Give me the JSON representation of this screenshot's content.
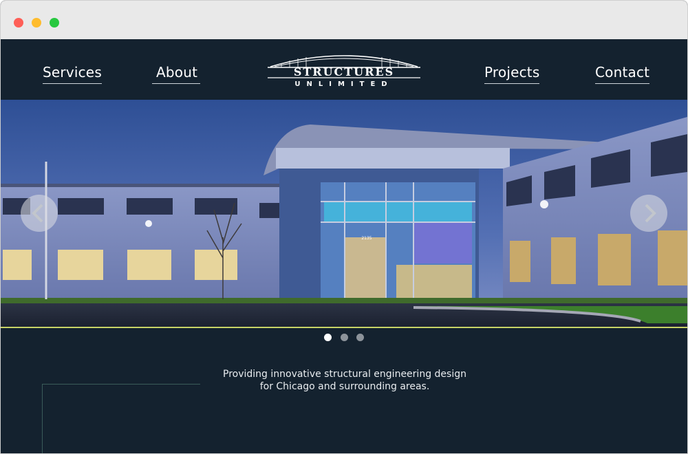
{
  "nav": {
    "left_links": [
      "Services",
      "About"
    ],
    "right_links": [
      "Projects",
      "Contact"
    ]
  },
  "logo": {
    "line1": "STRUCTURES",
    "line2": "UNLIMITED"
  },
  "hero": {
    "building_number": "2135",
    "slider": {
      "total_slides": 3,
      "active_slide": 1
    }
  },
  "tagline": {
    "line1": "Providing innovative structural engineering design",
    "line2": "for Chicago and surrounding areas."
  },
  "colors": {
    "background": "#14222f",
    "accent_line": "#c8d266",
    "decor_line": "#3a5c5a"
  }
}
